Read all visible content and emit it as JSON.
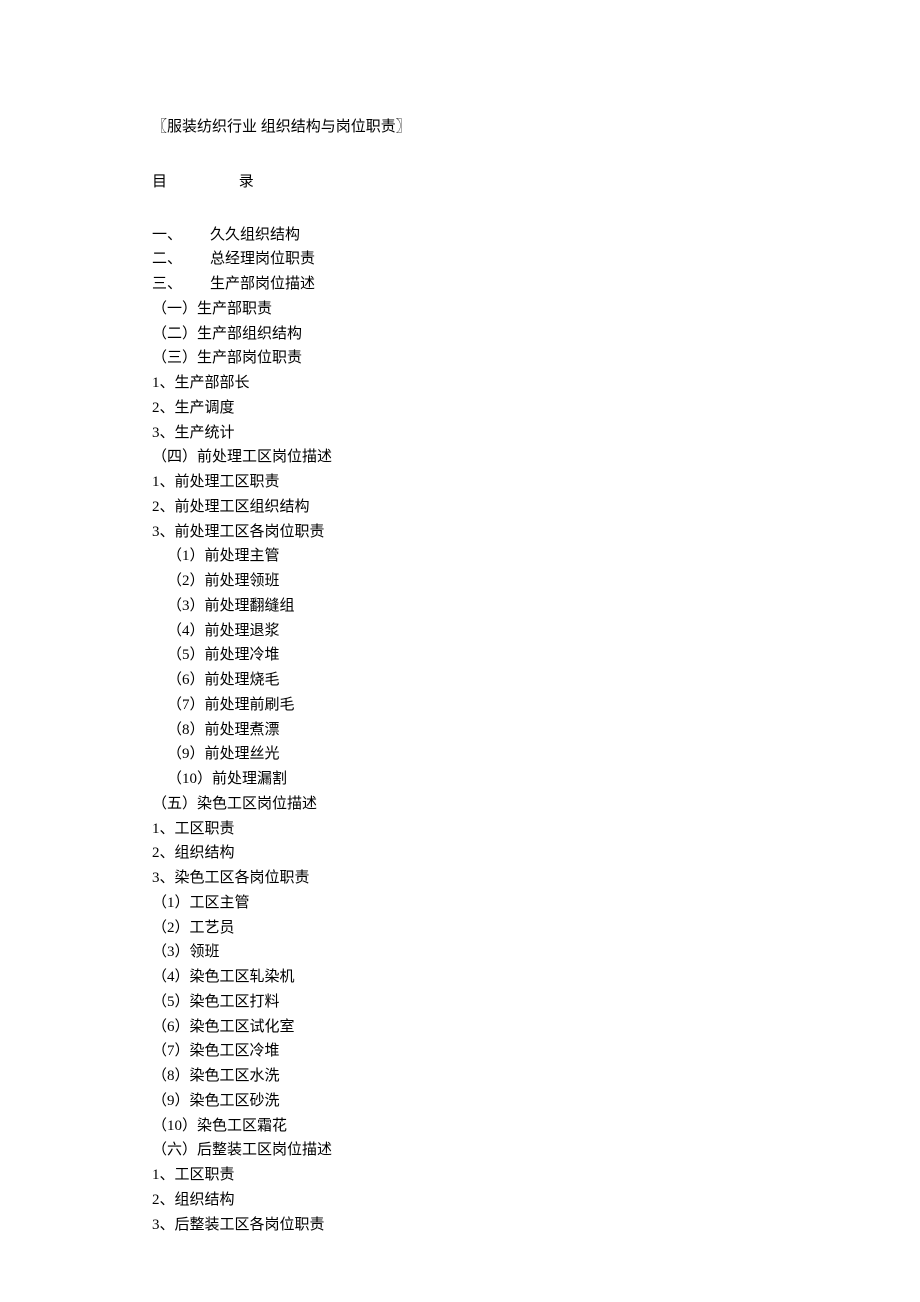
{
  "title": "〖服装纺织行业 组织结构与岗位职责〗",
  "tocHeading": {
    "mu": "目",
    "lu": "录"
  },
  "items": [
    {
      "text": "一、",
      "label": "久久组织结构",
      "cls": "indent-section"
    },
    {
      "text": "二、",
      "label": "总经理岗位职责",
      "cls": "indent-section"
    },
    {
      "text": "三、",
      "label": "生产部岗位描述",
      "cls": "indent-section"
    },
    {
      "text": "（一）生产部职责",
      "cls": "indent-1"
    },
    {
      "text": "（二）生产部组织结构",
      "cls": "indent-1"
    },
    {
      "text": "（三）生产部岗位职责",
      "cls": "indent-1"
    },
    {
      "text": "1、生产部部长",
      "cls": ""
    },
    {
      "text": "2、生产调度",
      "cls": ""
    },
    {
      "text": "3、生产统计",
      "cls": ""
    },
    {
      "text": "（四）前处理工区岗位描述",
      "cls": "indent-1"
    },
    {
      "text": "1、前处理工区职责",
      "cls": ""
    },
    {
      "text": "2、前处理工区组织结构",
      "cls": ""
    },
    {
      "text": "3、前处理工区各岗位职责",
      "cls": ""
    },
    {
      "text": "（1）前处理主管",
      "cls": "indent-2"
    },
    {
      "text": "（2）前处理领班",
      "cls": "indent-2"
    },
    {
      "text": "（3）前处理翻缝组",
      "cls": "indent-2"
    },
    {
      "text": "（4）前处理退浆",
      "cls": "indent-2"
    },
    {
      "text": "（5）前处理冷堆",
      "cls": "indent-2"
    },
    {
      "text": "（6）前处理烧毛",
      "cls": "indent-2"
    },
    {
      "text": "（7）前处理前刷毛",
      "cls": "indent-2"
    },
    {
      "text": "（8）前处理煮漂",
      "cls": "indent-2"
    },
    {
      "text": "（9）前处理丝光",
      "cls": "indent-2"
    },
    {
      "text": "（10）前处理漏割",
      "cls": "indent-2"
    },
    {
      "text": "（五）染色工区岗位描述",
      "cls": "indent-1"
    },
    {
      "text": "1、工区职责",
      "cls": ""
    },
    {
      "text": "2、组织结构",
      "cls": ""
    },
    {
      "text": "3、染色工区各岗位职责",
      "cls": ""
    },
    {
      "text": "（1）工区主管",
      "cls": "indent-1"
    },
    {
      "text": "（2）工艺员",
      "cls": "indent-1"
    },
    {
      "text": "（3）领班",
      "cls": "indent-1"
    },
    {
      "text": "（4）染色工区轧染机",
      "cls": "indent-1"
    },
    {
      "text": "（5）染色工区打料",
      "cls": "indent-1"
    },
    {
      "text": "（6）染色工区试化室",
      "cls": "indent-1"
    },
    {
      "text": "（7）染色工区冷堆",
      "cls": "indent-1"
    },
    {
      "text": "（8）染色工区水洗",
      "cls": "indent-1"
    },
    {
      "text": "（9）染色工区砂洗",
      "cls": "indent-1"
    },
    {
      "text": "（10）染色工区霜花",
      "cls": "indent-1"
    },
    {
      "text": "（六）后整装工区岗位描述",
      "cls": "indent-1"
    },
    {
      "text": "1、工区职责",
      "cls": ""
    },
    {
      "text": "2、组织结构",
      "cls": ""
    },
    {
      "text": "3、后整装工区各岗位职责",
      "cls": ""
    }
  ]
}
